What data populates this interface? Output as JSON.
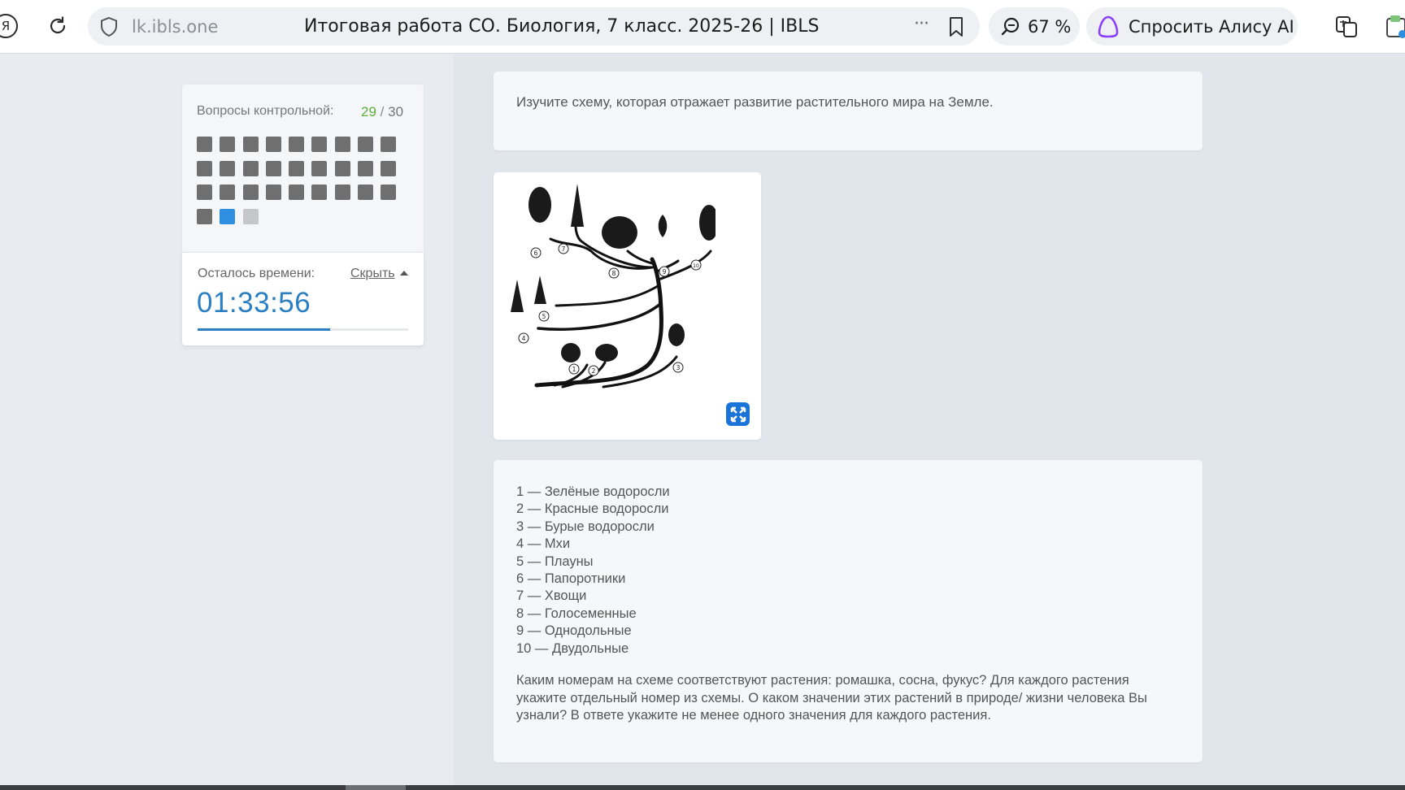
{
  "browser": {
    "logo_glyph": "Я",
    "url_domain": "lk.ibls.one",
    "page_title": "Итоговая работа СО. Биология, 7 класс. 2025-26 | IBLS",
    "menu_glyph": "···",
    "zoom_label": "67 %",
    "alice_label": "Спросить Алису AI"
  },
  "sidebar": {
    "questions_label": "Вопросы контрольной:",
    "current": "29",
    "separator": "/",
    "total": "30",
    "questions": [
      "done",
      "done",
      "done",
      "done",
      "done",
      "done",
      "done",
      "done",
      "done",
      "done",
      "done",
      "done",
      "done",
      "done",
      "done",
      "done",
      "done",
      "done",
      "done",
      "done",
      "done",
      "done",
      "done",
      "done",
      "done",
      "done",
      "done",
      "done",
      "current",
      "empty"
    ],
    "time_label": "Осталось времени:",
    "hide_label": "Скрыть",
    "time_value": "01:33:56",
    "time_progress": 0.63
  },
  "content": {
    "intro": "Изучите схему, которая отражает развитие растительного мира на Земле.",
    "scheme_numbers": [
      "1",
      "2",
      "3",
      "4",
      "5",
      "6",
      "7",
      "8",
      "9",
      "10"
    ],
    "legend": [
      "1 — Зелёные водоросли",
      "2 — Красные водоросли",
      "3 — Бурые водоросли",
      "4 — Мхи",
      "5 — Плауны",
      "6 — Папоротники",
      "7 — Хвощи",
      "8 — Голосеменные",
      "9 — Однодольные",
      "10 — Двудольные"
    ],
    "question": "Каким номерам на схеме соответствуют растения: ромашка, сосна, фукус? Для каждого растения укажите отдельный номер из схемы. О каком значении этих растений в природе/ жизни человека Вы узнали? В ответе укажите не менее одного значения для каждого растения."
  },
  "colors": {
    "accent_blue": "#2a7fc3",
    "answered": "#6f6f6f",
    "current": "#2e8fe0",
    "unanswered": "#c4c6c9",
    "counter_green": "#5caf3a"
  }
}
